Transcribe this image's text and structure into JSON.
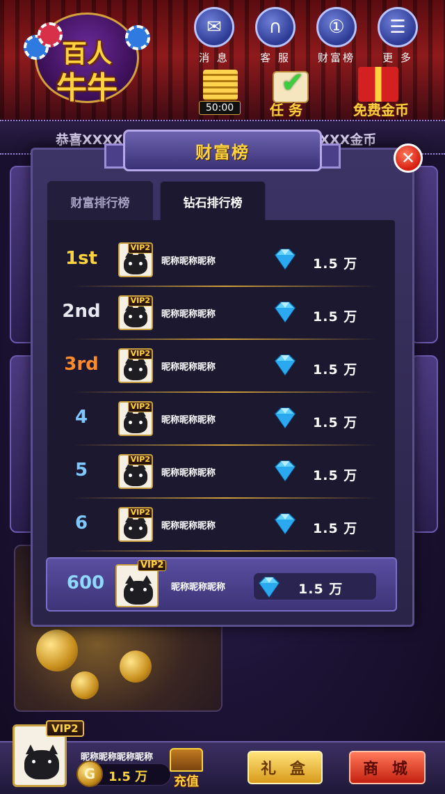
{
  "header": {
    "logo_line1": "百人",
    "logo_line2": "牛牛",
    "nav": [
      {
        "label": "消 息",
        "icon": "message-icon"
      },
      {
        "label": "客 服",
        "icon": "headset-icon"
      },
      {
        "label": "财富榜",
        "icon": "medal-icon"
      },
      {
        "label": "更 多",
        "icon": "menu-icon"
      }
    ],
    "timer": "50:00",
    "task_label": "任 务",
    "free_gold_label": "免费金币"
  },
  "marquee": {
    "left": "恭喜XXXXX获",
    "right": "XXXXX金币"
  },
  "modal": {
    "title": "财富榜",
    "close_symbol": "✕",
    "tabs": [
      {
        "label": "财富排行榜",
        "active": false
      },
      {
        "label": "钻石排行榜",
        "active": true
      }
    ],
    "rows": [
      {
        "rank": "1st",
        "vip": "VIP2",
        "name": "昵称昵称昵称",
        "amount": "1.5 万",
        "rank_color": "#ffd33d"
      },
      {
        "rank": "2nd",
        "vip": "VIP2",
        "name": "昵称昵称昵称",
        "amount": "1.5 万",
        "rank_color": "#e8e8f0"
      },
      {
        "rank": "3rd",
        "vip": "VIP2",
        "name": "昵称昵称昵称",
        "amount": "1.5 万",
        "rank_color": "#ff8a2a"
      },
      {
        "rank": "4",
        "vip": "VIP2",
        "name": "昵称昵称昵称",
        "amount": "1.5 万",
        "rank_color": "#7ec8ff"
      },
      {
        "rank": "5",
        "vip": "VIP2",
        "name": "昵称昵称昵称",
        "amount": "1.5 万",
        "rank_color": "#7ec8ff"
      },
      {
        "rank": "6",
        "vip": "VIP2",
        "name": "昵称昵称昵称",
        "amount": "1.5 万",
        "rank_color": "#7ec8ff"
      }
    ],
    "self": {
      "rank": "600",
      "vip": "VIP2",
      "name": "昵称昵称昵称",
      "amount": "1.5 万"
    }
  },
  "player": {
    "vip": "VIP2",
    "name": "昵称昵称昵称昵称",
    "coin_symbol": "G",
    "coins": "1.5 万",
    "recharge_label": "充值"
  },
  "buttons": {
    "gift": "礼 盒",
    "shop": "商 城"
  },
  "colors": {
    "accent_gold": "#ffd33d",
    "modal_bg": "#2a2448",
    "close_red": "#d61c10"
  }
}
